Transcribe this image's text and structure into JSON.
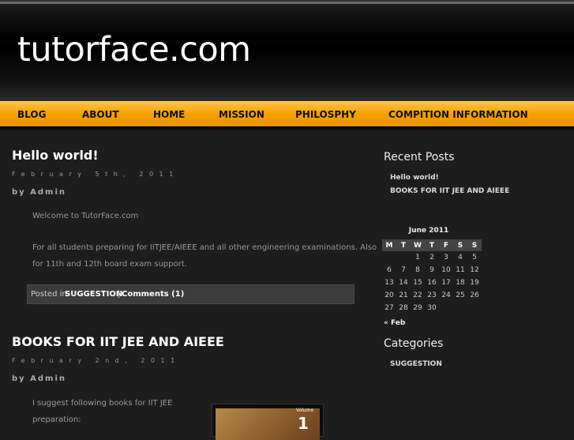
{
  "site": {
    "title": "tutorface.com"
  },
  "nav": [
    "BLOG",
    "ABOUT",
    "HOME",
    "MISSION",
    "PHILOSPHY",
    "COMPITION INFORMATION"
  ],
  "posts": [
    {
      "title": "Hello world!",
      "date": "February 5th, 2011",
      "author": "by Admin",
      "paragraphs": [
        "Welcome to TutorFace.com",
        "For all students preparing for IITJEE/AIEEE and all other engineering examinations. Also",
        "for 11th and 12th board exam support."
      ],
      "meta": {
        "posted_in": "Posted in",
        "category": "SUGGESTION",
        "sep": "|",
        "comments": "Comments (1)"
      }
    },
    {
      "title": "BOOKS FOR IIT JEE AND AIEEE",
      "date": "February 2nd, 2011",
      "author": "by Admin",
      "paragraphs": [
        "I suggest following books for IIT JEE",
        "preparation:"
      ],
      "image": {
        "volume_label": "Volume",
        "volume_number": "1"
      }
    }
  ],
  "sidebar": {
    "recent_heading": "Recent Posts",
    "recent": [
      "Hello world!",
      "BOOKS FOR IIT JEE AND AIEEE"
    ],
    "calendar": {
      "caption": "June 2011",
      "headers": [
        "M",
        "T",
        "W",
        "T",
        "F",
        "S",
        "S"
      ],
      "weeks": [
        [
          "",
          "",
          "1",
          "2",
          "3",
          "4",
          "5"
        ],
        [
          "6",
          "7",
          "8",
          "9",
          "10",
          "11",
          "12"
        ],
        [
          "13",
          "14",
          "15",
          "16",
          "17",
          "18",
          "19"
        ],
        [
          "20",
          "21",
          "22",
          "23",
          "24",
          "25",
          "26"
        ],
        [
          "27",
          "28",
          "29",
          "30",
          "",
          "",
          ""
        ]
      ],
      "prev": "« Feb"
    },
    "categories_heading": "Categories",
    "categories": [
      "SUGGESTION"
    ]
  }
}
